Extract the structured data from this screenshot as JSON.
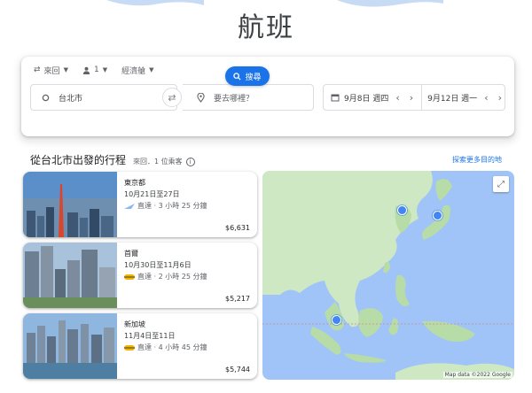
{
  "page": {
    "title": "航班"
  },
  "search": {
    "trip_type": "來回",
    "passengers": "1",
    "cabin": "經濟艙",
    "origin": "台北市",
    "destination_placeholder": "要去哪裡？",
    "depart_date": "9月8日 週四",
    "return_date": "9月12日 週一",
    "search_label": "搜尋"
  },
  "section": {
    "title": "從台北市出發的行程",
    "subtitle": "來回．1 位乘客",
    "explore_label": "探索更多目的地"
  },
  "destinations": [
    {
      "city": "東京都",
      "dates": "10月21日至27日",
      "flight": "直達 · 3 小時 25 分鐘",
      "price": "$6,631"
    },
    {
      "city": "首爾",
      "dates": "10月30日至11月6日",
      "flight": "直達 · 2 小時 25 分鐘",
      "price": "$5,217"
    },
    {
      "city": "新加坡",
      "dates": "11月4日至11日",
      "flight": "直達 · 4 小時 45 分鐘",
      "price": "$5,744"
    }
  ],
  "map": {
    "attribution": "Map data ©2022 Google"
  },
  "colors": {
    "accent": "#1a73e8",
    "water": "#a0c4f7",
    "land": "#cde8c3"
  }
}
